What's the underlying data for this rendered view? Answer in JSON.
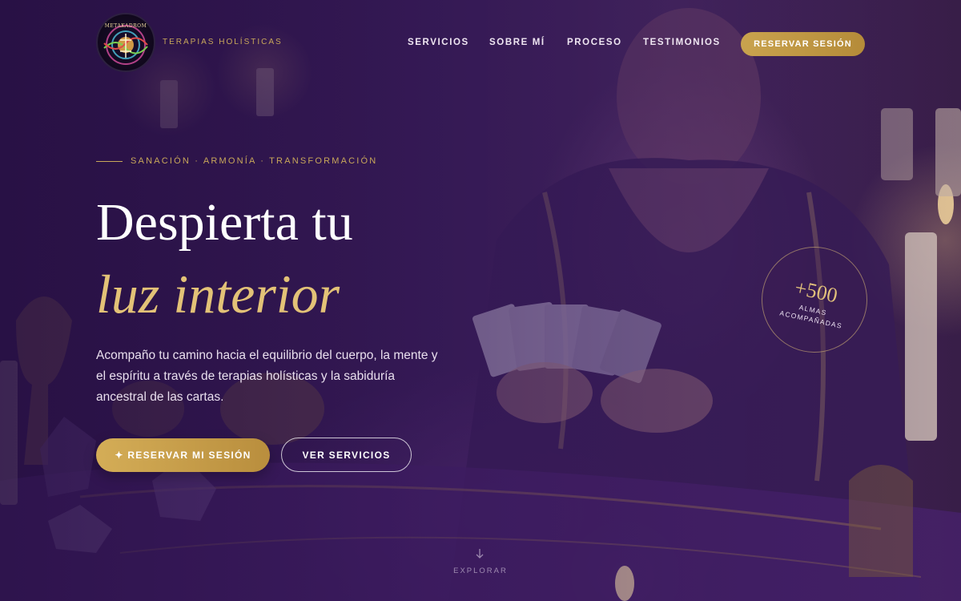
{
  "brand": {
    "logo_text": "METAKADROM",
    "tagline": "TERAPIAS HOLÍSTICAS"
  },
  "nav": {
    "items": [
      "SERVICIOS",
      "SOBRE MÍ",
      "PROCESO",
      "TESTIMONIOS"
    ],
    "cta": "RESERVAR SESIÓN"
  },
  "hero": {
    "eyebrow": "SANACIÓN · ARMONÍA · TRANSFORMACIÓN",
    "title_line1": "Despierta tu",
    "title_line2": "luz interior",
    "lead": "Acompaño tu camino hacia el equilibrio del cuerpo, la mente y el espíritu a través de terapias holísticas y la sabiduría ancestral de las cartas.",
    "primary_button": "✦ RESERVAR MI SESIÓN",
    "secondary_button": "VER SERVICIOS"
  },
  "stat": {
    "number": "+500",
    "label": "ALMAS ACOMPAÑADAS"
  },
  "scroll": {
    "label": "EXPLORAR"
  },
  "colors": {
    "gold": "#c9a85a",
    "gold_title": "#e3c277",
    "purple_bg": "#2b1640"
  },
  "icons": {
    "scroll": "arrow-down-icon",
    "sparkle": "sparkle-icon"
  }
}
